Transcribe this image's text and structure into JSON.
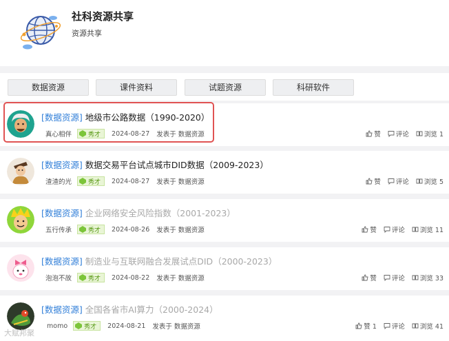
{
  "header": {
    "title": "社科资源共享",
    "subtitle": "资源共享"
  },
  "tabs": [
    "数据资源",
    "课件资料",
    "试题资源",
    "科研软件"
  ],
  "badge_label": "秀才",
  "posted_prefix": "发表于",
  "posts": [
    {
      "category": "[数据资源]",
      "title": "地级市公路数据（1990-2020）",
      "user": "真心相伴",
      "date": "2024-08-27",
      "section": "数据资源",
      "like": "赞",
      "comment": "评论",
      "views": "浏览 1"
    },
    {
      "category": "[数据资源]",
      "title": "数据交易平台试点城市DID数据（2009-2023）",
      "user": "渣渣的光",
      "date": "2024-08-27",
      "section": "数据资源",
      "like": "赞",
      "comment": "评论",
      "views": "浏览 5"
    },
    {
      "category": "[数据资源]",
      "title": "企业网络安全风险指数（2001-2023）",
      "user": "五行传承",
      "date": "2024-08-26",
      "section": "数据资源",
      "like": "赞",
      "comment": "评论",
      "views": "浏览 11"
    },
    {
      "category": "[数据资源]",
      "title": "制造业与互联网融合发展试点DID（2000-2023）",
      "user": "泡泡不故",
      "date": "2024-08-22",
      "section": "数据资源",
      "like": "赞",
      "comment": "评论",
      "views": "浏览 33"
    },
    {
      "category": "[数据资源]",
      "title": "全国各省市AI算力（2000-2024）",
      "user": "momo",
      "date": "2024-08-21",
      "section": "数据资源",
      "like": "赞 1",
      "comment": "评论",
      "views": "浏览 41"
    }
  ],
  "watermark": "大赋邦聚"
}
